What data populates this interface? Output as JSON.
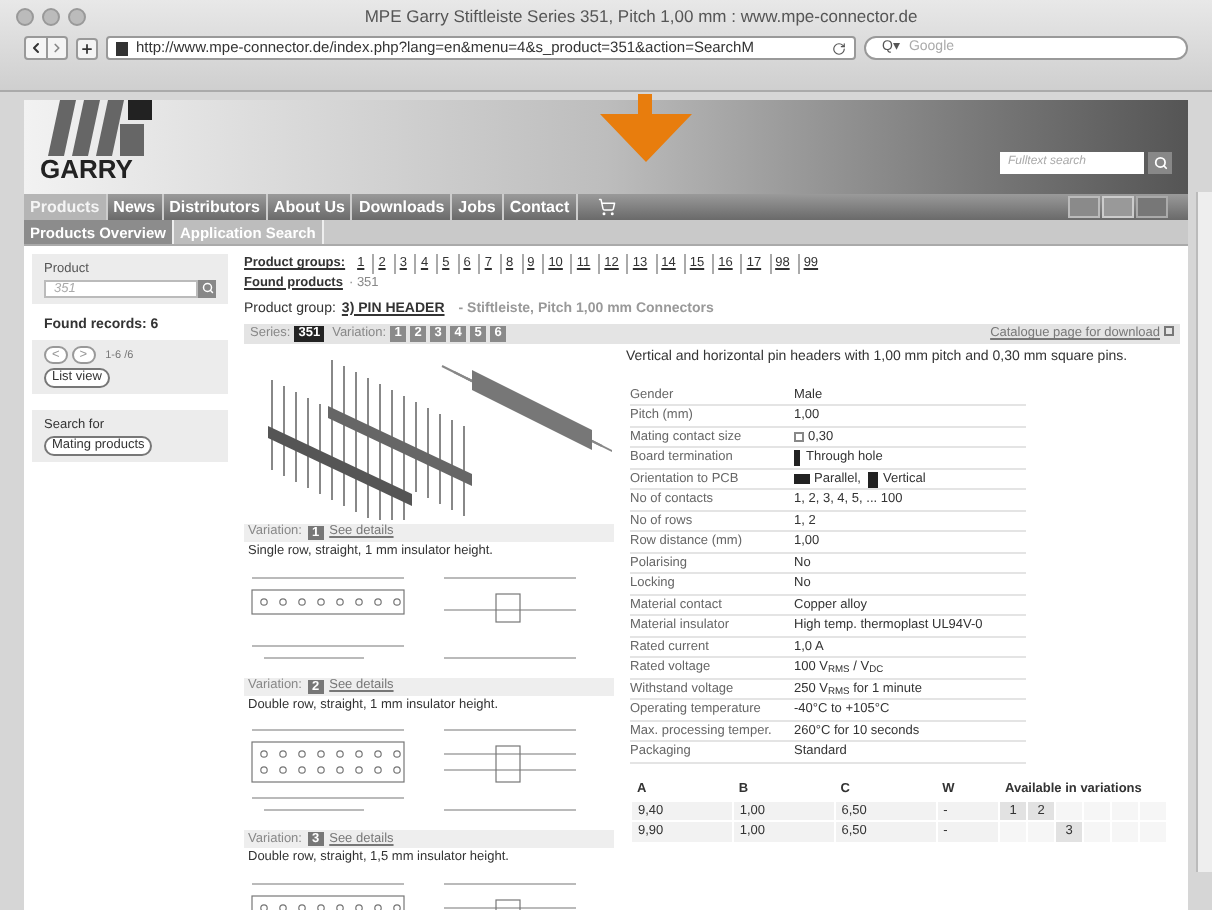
{
  "window": {
    "title": "MPE Garry Stiftleiste Series 351, Pitch 1,00 mm : www.mpe-connector.de",
    "url": "http://www.mpe-connector.de/index.php?lang=en&menu=4&s_product=351&action=SearchM",
    "search_placeholder": "Google",
    "search_prefix": "Q▾"
  },
  "header": {
    "logo_text": "GARRY",
    "search_placeholder": "Fulltext search"
  },
  "nav": [
    {
      "label": "Products",
      "selected": true
    },
    {
      "label": "News",
      "selected": false
    },
    {
      "label": "Distributors",
      "selected": false
    },
    {
      "label": "About Us",
      "selected": false
    },
    {
      "label": "Downloads",
      "selected": false
    },
    {
      "label": "Jobs",
      "selected": false
    },
    {
      "label": "Contact",
      "selected": false
    }
  ],
  "subnav": [
    {
      "label": "Products Overview",
      "selected": true
    },
    {
      "label": "Application Search",
      "selected": false
    }
  ],
  "sidebar": {
    "product_label": "Product",
    "product_value": "351",
    "found": "Found records: 6",
    "prev": "<",
    "next": ">",
    "range": "1-6 /6",
    "list_view": "List view",
    "search_for": "Search for",
    "mating": "Mating products"
  },
  "groups": {
    "label": "Product groups:",
    "items": [
      "1",
      "2",
      "3",
      "4",
      "5",
      "6",
      "7",
      "8",
      "9",
      "10",
      "11",
      "12",
      "13",
      "14",
      "15",
      "16",
      "17",
      "98",
      "99"
    ],
    "found_label": "Found products",
    "found_value": "· 351",
    "group_label": "Product group:",
    "group_link": "3) PIN HEADER",
    "group_desc": "- Stiftleiste, Pitch 1,00 mm Connectors"
  },
  "series_bar": {
    "series_label": "Series:",
    "series": [
      {
        "label": "351",
        "selected": true
      }
    ],
    "variation_label": "Variation:",
    "variations": [
      {
        "label": "1",
        "selected": false
      },
      {
        "label": "2",
        "selected": false
      },
      {
        "label": "3",
        "selected": false
      },
      {
        "label": "4",
        "selected": false
      },
      {
        "label": "5",
        "selected": false
      },
      {
        "label": "6",
        "selected": false
      }
    ],
    "catalogue": "Catalogue page for download"
  },
  "variation_blocks": [
    {
      "label": "Variation:",
      "number": "1",
      "link": "See details",
      "desc": "Single row, straight, 1 mm insulator height.",
      "kind": "single"
    },
    {
      "label": "Variation:",
      "number": "2",
      "link": "See details",
      "desc": "Double row, straight, 1 mm insulator height.",
      "kind": "double"
    },
    {
      "label": "Variation:",
      "number": "3",
      "link": "See details",
      "desc": "Double row, straight, 1,5 mm insulator height.",
      "kind": "double"
    }
  ],
  "description": "Vertical and horizontal pin headers with 1,00 mm pitch and 0,30 mm square pins.",
  "specs": [
    {
      "label": "Gender",
      "value": "Male"
    },
    {
      "label": "Pitch (mm)",
      "value": "1,00"
    },
    {
      "label": "Mating contact size",
      "value": "0,30",
      "kind": "square"
    },
    {
      "label": "Board termination",
      "value": "Through hole",
      "kind": "pin"
    },
    {
      "label": "Orientation to PCB",
      "value": "Parallel,",
      "value2": "Vertical",
      "kind": "orientation"
    },
    {
      "label": "No of contacts",
      "value": "1, 2, 3, 4, 5, ... 100"
    },
    {
      "label": "No of rows",
      "value": "1, 2"
    },
    {
      "label": "Row distance (mm)",
      "value": "1,00"
    },
    {
      "label": "Polarising",
      "value": "No"
    },
    {
      "label": "Locking",
      "value": "No"
    },
    {
      "label": "Material contact",
      "value": "Copper alloy"
    },
    {
      "label": "Material insulator",
      "value": "High temp. thermoplast UL94V-0"
    },
    {
      "label": "Rated current",
      "value": "1,0 A"
    },
    {
      "label": "Rated voltage",
      "value": "100 V$_{RMS}$ / V$_{DC}$"
    },
    {
      "label": "Withstand voltage",
      "value": "250 V$_{RMS}$ for 1 minute"
    },
    {
      "label": "Operating temperature",
      "value": "-40°C to +105°C"
    },
    {
      "label": "Max. processing temper.",
      "value": "260°C for 10 seconds"
    },
    {
      "label": "Packaging",
      "value": "Standard"
    }
  ],
  "dim_table": {
    "columns": [
      "A",
      "B",
      "C",
      "W",
      "Available in variations"
    ],
    "rows": [
      {
        "cells": [
          "9,40",
          "1,00",
          "6,50",
          "-"
        ],
        "variations": [
          {
            "available": true,
            "label": "1"
          },
          {
            "available": true,
            "label": "2"
          },
          {
            "available": false
          },
          {
            "available": false
          },
          {
            "available": false
          },
          {
            "available": false
          }
        ]
      },
      {
        "cells": [
          "9,90",
          "1,00",
          "6,50",
          "-"
        ],
        "variations": [
          {
            "available": false
          },
          {
            "available": false
          },
          {
            "available": true,
            "label": "3"
          },
          {
            "available": false
          },
          {
            "available": false
          },
          {
            "available": false
          }
        ]
      }
    ]
  }
}
